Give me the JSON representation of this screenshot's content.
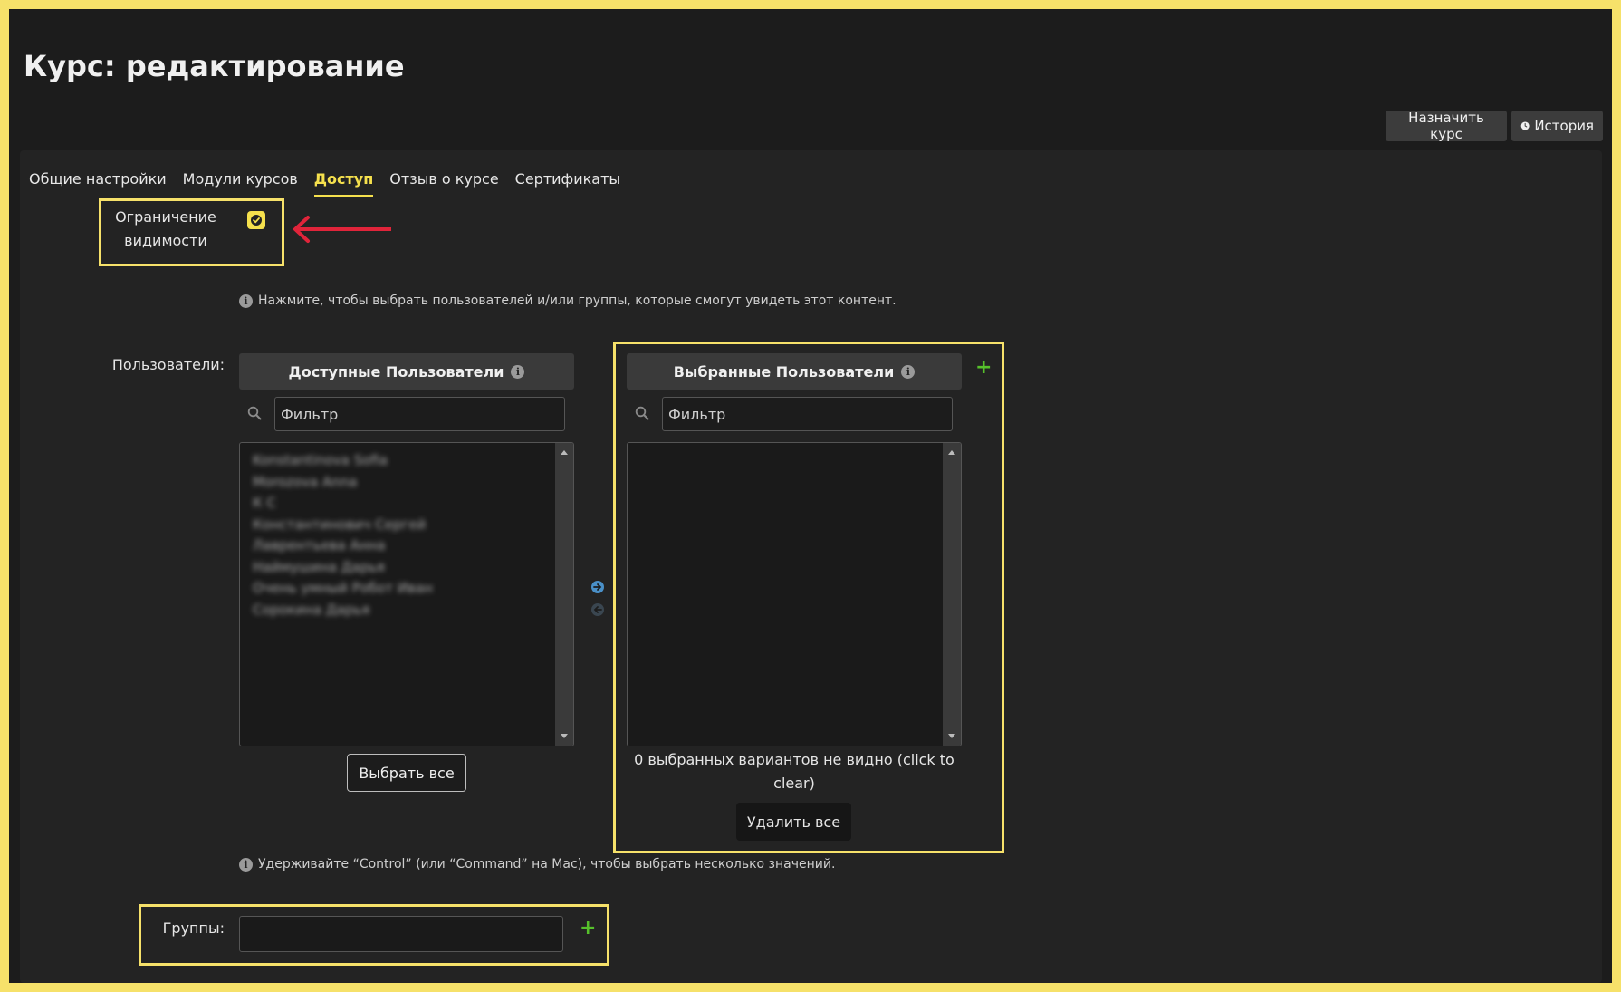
{
  "page": {
    "title": "Курс: редактирование"
  },
  "header_buttons": {
    "assign": "Назначить курс",
    "history": "История"
  },
  "tabs": [
    {
      "label": "Общие настройки",
      "active": false
    },
    {
      "label": "Модули курсов",
      "active": false
    },
    {
      "label": "Доступ",
      "active": true
    },
    {
      "label": "Отзыв о курсе",
      "active": false
    },
    {
      "label": "Сертификаты",
      "active": false
    }
  ],
  "visibility": {
    "label_line1": "Ограничение",
    "label_line2": "видимости",
    "checked": true,
    "hint": "Нажмите, чтобы выбрать пользователей и/или группы, которые смогут увидеть этот контент."
  },
  "users": {
    "label": "Пользователи:",
    "available": {
      "title": "Доступные Пользователи",
      "filter_placeholder": "Фильтр",
      "items": [
        "Konstantinova Sofia",
        "Morozova Anna",
        "К С",
        "Константинович Сергей",
        "Лаврентьева Анна",
        "Наймушина Дарья",
        "Очень умный Робот Иван",
        "Сорокина Дарья"
      ],
      "select_all": "Выбрать все"
    },
    "selected": {
      "title": "Выбранные Пользователи",
      "filter_placeholder": "Фильтр",
      "hidden_line1": "0 выбранных вариантов не видно (click to",
      "hidden_line2": "clear)",
      "remove_all": "Удалить все"
    },
    "multi_hint": "Удерживайте “Control” (или “Command” на Mac), чтобы выбрать несколько значений."
  },
  "groups": {
    "label": "Группы:"
  },
  "colors": {
    "accent": "#f5e04d",
    "frame": "#f6e16a",
    "plus": "#56c02b",
    "arrow_red": "#e0243a",
    "move_arrow": "#4a90c8"
  }
}
